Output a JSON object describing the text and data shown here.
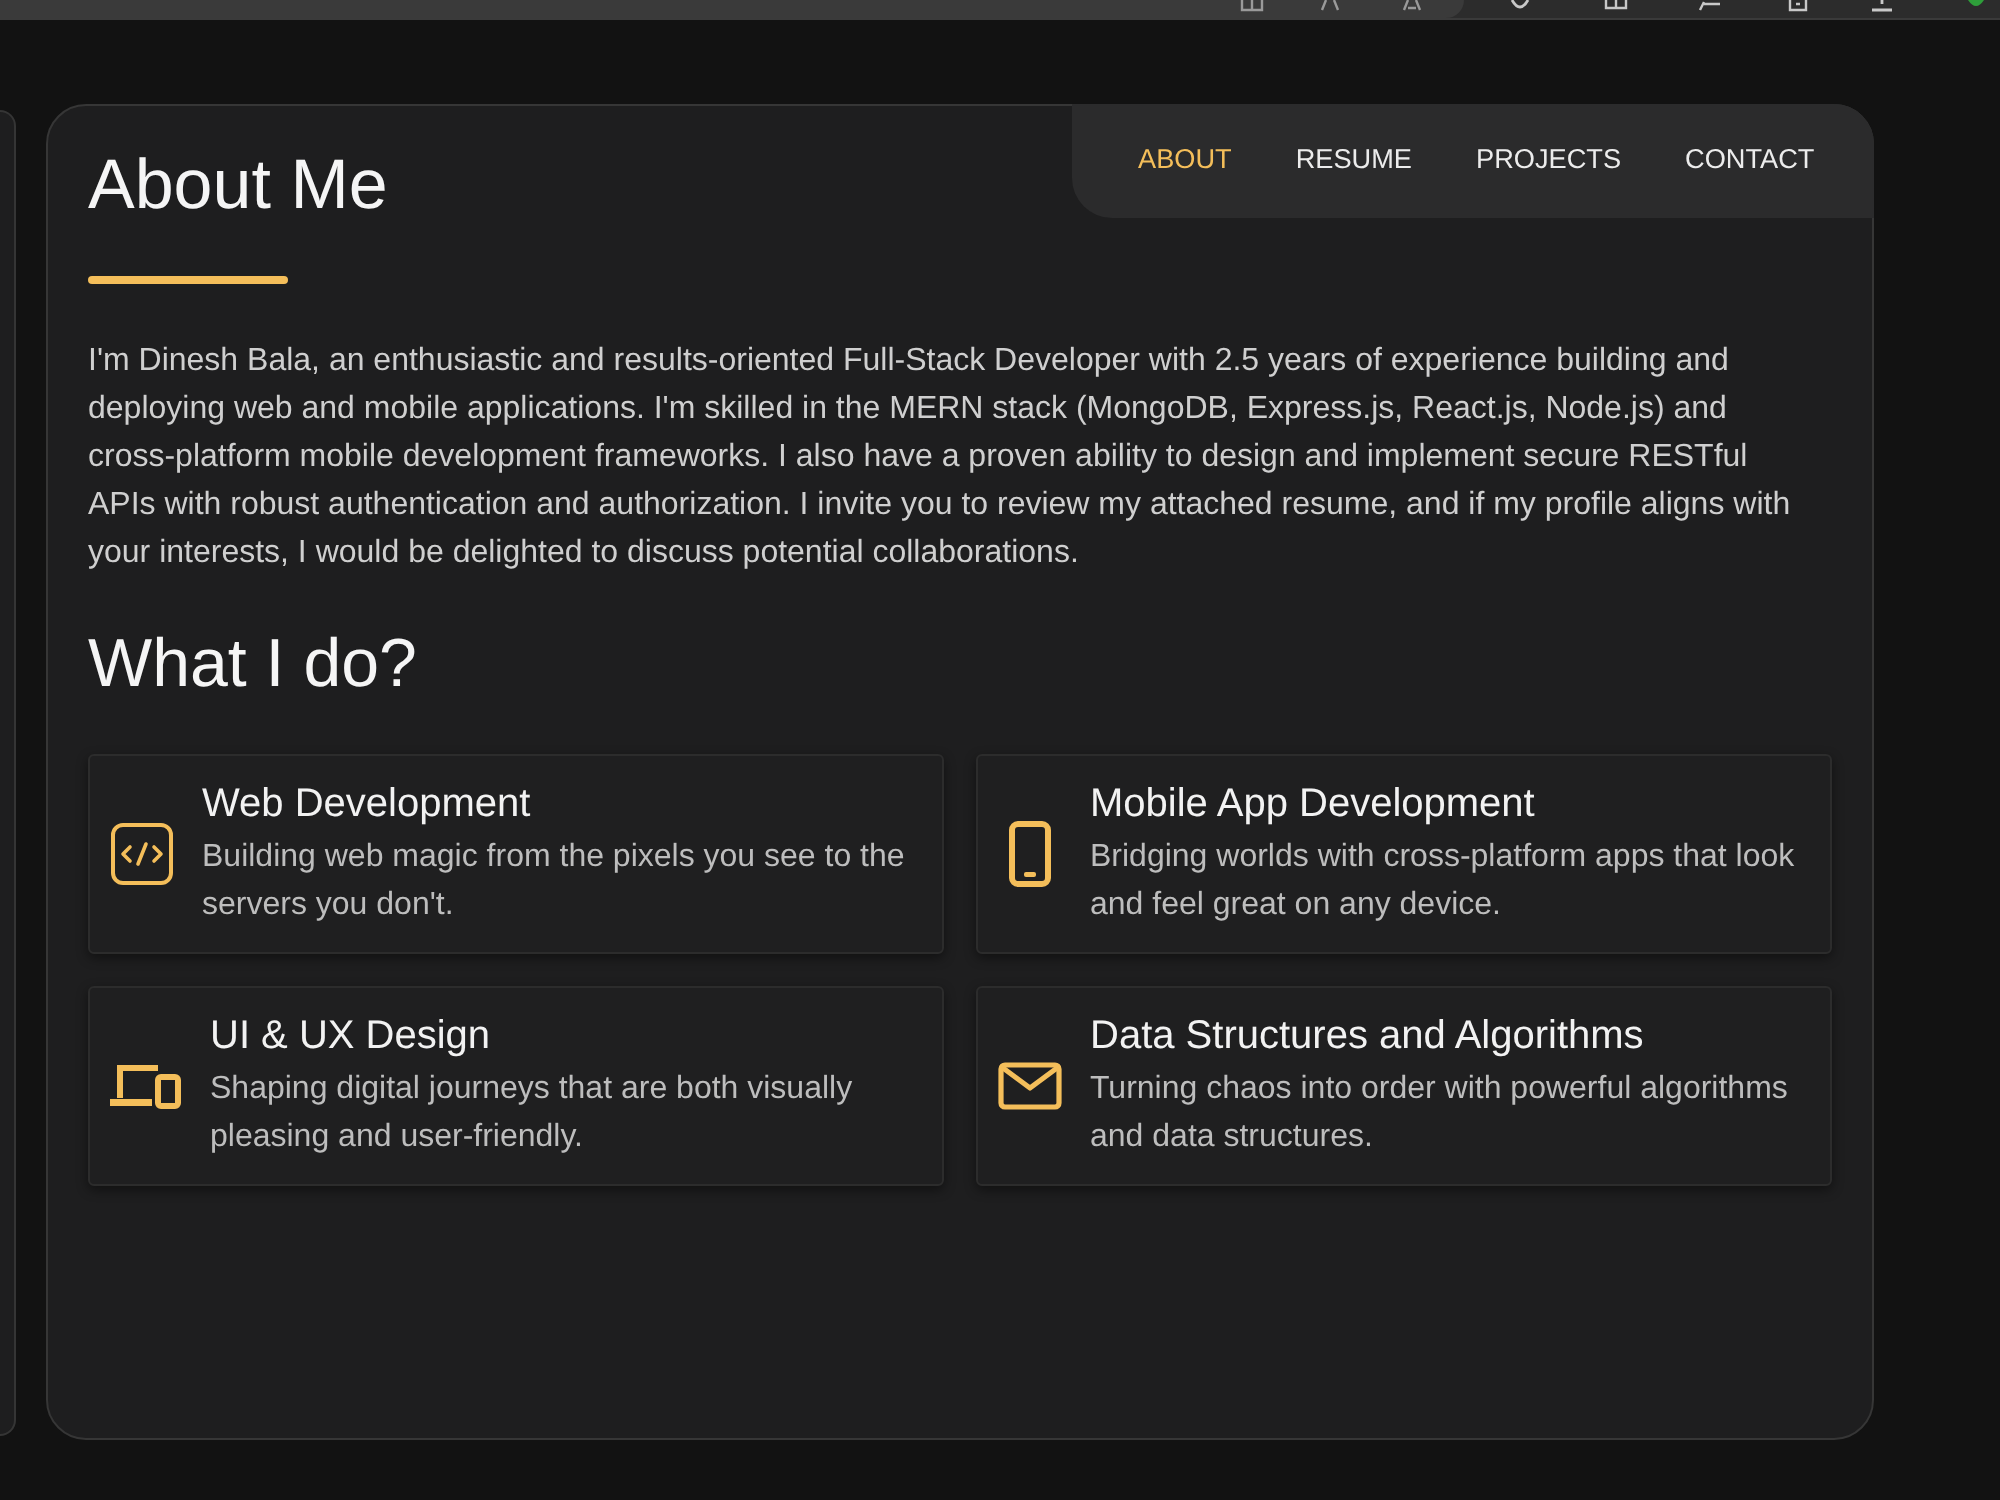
{
  "nav": [
    {
      "label": "ABOUT",
      "selected": true
    },
    {
      "label": "RESUME",
      "selected": false
    },
    {
      "label": "PROJECTS",
      "selected": false
    },
    {
      "label": "CONTACT",
      "selected": false
    }
  ],
  "about": {
    "title": "About Me",
    "text": "I'm Dinesh Bala, an enthusiastic and results-oriented Full-Stack Developer with 2.5 years of experience building and deploying web and mobile applications. I'm skilled in the MERN stack (MongoDB, Express.js, React.js, Node.js) and cross-platform mobile development frameworks. I also have a proven ability to design and implement secure RESTful APIs with robust authentication and authorization. I invite you to review my attached resume, and if my profile aligns with your interests, I would be delighted to discuss potential collaborations."
  },
  "services": {
    "title": "What I do?",
    "items": [
      {
        "kind": "code",
        "title": "Web Development",
        "description": "Building web magic from the pixels you see to the servers you don't."
      },
      {
        "kind": "phone",
        "title": "Mobile App Development",
        "description": "Bridging worlds with cross-platform apps that look and feel great on any device."
      },
      {
        "kind": "devices",
        "title": "UI & UX Design",
        "description": "Shaping digital journeys that are both visually pleasing and user-friendly."
      },
      {
        "kind": "mail",
        "title": "Data Structures and Algorithms",
        "description": "Turning chaos into order with powerful algorithms and data structures."
      }
    ]
  }
}
